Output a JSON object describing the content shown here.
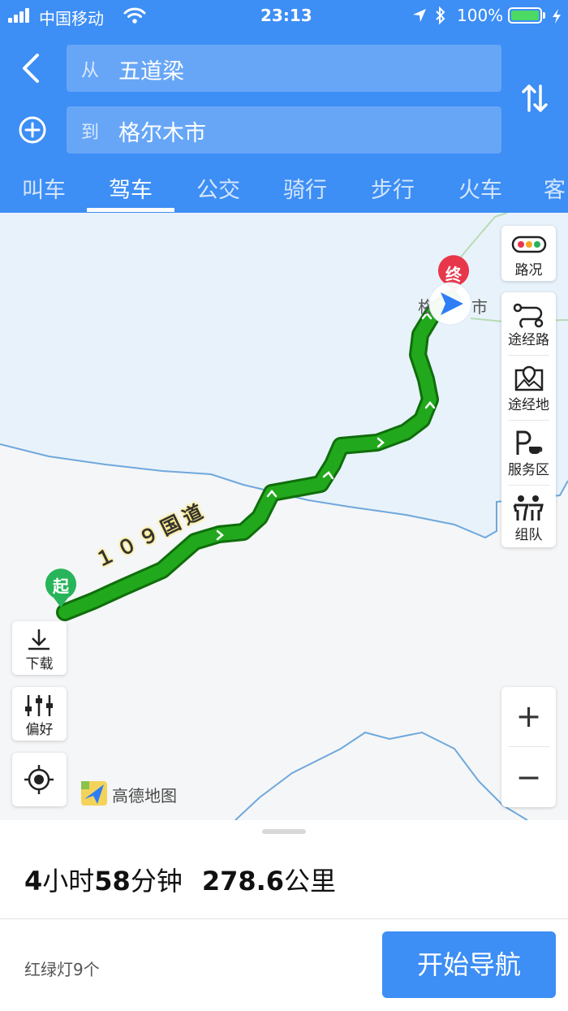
{
  "status_bar": {
    "carrier": "中国移动",
    "time": "23:13",
    "battery_percent": "100%",
    "battery_level": 1.0
  },
  "route_inputs": {
    "from_prefix": "从",
    "from_value": "五道梁",
    "to_prefix": "到",
    "to_value": "格尔木市"
  },
  "tabs": [
    {
      "label": "叫车"
    },
    {
      "label": "驾车",
      "active": true
    },
    {
      "label": "公交"
    },
    {
      "label": "骑行"
    },
    {
      "label": "步行"
    },
    {
      "label": "火车"
    },
    {
      "label": "客"
    }
  ],
  "map": {
    "road_label": "１０９国道",
    "start_label": "起",
    "end_label": "终",
    "city_label_left": "格",
    "city_label_right": "市",
    "logo_text": "高德地图",
    "colors": {
      "route": "#22a81c",
      "route_edge": "#0f6e0c",
      "river": "#6fa8dc",
      "water_area": "#e8f2fb",
      "start_marker": "#27b45a",
      "end_marker": "#e8374a",
      "location_marker": "#2f7df6"
    }
  },
  "controls": {
    "traffic": "路况",
    "waypoint_route": "途经路",
    "waypoint_place": "途经地",
    "service_area": "服务区",
    "team": "组队",
    "download": "下载",
    "preference": "偏好",
    "zoom_in": "+",
    "zoom_out": "−"
  },
  "summary": {
    "hours": "4",
    "hours_unit": "小时",
    "minutes": "58",
    "minutes_unit": "分钟",
    "distance": "278.6",
    "distance_unit": "公里",
    "traffic_lights": "红绿灯9个",
    "start_nav": "开始导航"
  },
  "theme": {
    "accent": "#3d8ef5"
  }
}
